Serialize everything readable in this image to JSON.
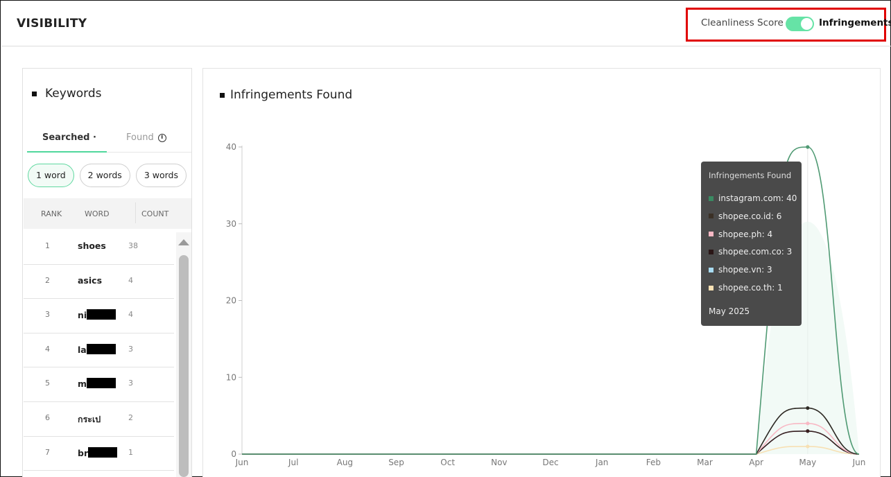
{
  "header": {
    "title": "VISIBILITY",
    "toggle": {
      "left_label": "Cleanliness Score",
      "right_label": "Infringements",
      "state": "right"
    }
  },
  "keywords": {
    "title": "Keywords",
    "tabs": {
      "searched": "Searched ·",
      "found": "Found"
    },
    "pills": [
      "1 word",
      "2 words",
      "3 words"
    ],
    "active_pill": "1 word",
    "columns": {
      "rank": "RANK",
      "word": "WORD",
      "count": "COUNT"
    },
    "rows": [
      {
        "rank": "1",
        "word": "shoes",
        "count": "38",
        "redacted": false
      },
      {
        "rank": "2",
        "word": "asics",
        "count": "4",
        "redacted": false
      },
      {
        "rank": "3",
        "word": "ni",
        "count": "4",
        "redacted": true
      },
      {
        "rank": "4",
        "word": "la",
        "count": "3",
        "redacted": true
      },
      {
        "rank": "5",
        "word": "m",
        "count": "3",
        "redacted": true
      },
      {
        "rank": "6",
        "word": "กระเป",
        "count": "2",
        "redacted": false
      },
      {
        "rank": "7",
        "word": "br",
        "count": "1",
        "redacted": true
      }
    ]
  },
  "infringements": {
    "title": "Infringements Found",
    "tooltip": {
      "title": "Infringements Found",
      "items": [
        {
          "label": "instagram.com: 40",
          "color": "#3a8a62"
        },
        {
          "label": "shopee.co.id: 6",
          "color": "#3b3026"
        },
        {
          "label": "shopee.ph: 4",
          "color": "#f8b8c4"
        },
        {
          "label": "shopee.com.co: 3",
          "color": "#2a1616"
        },
        {
          "label": "shopee.vn: 3",
          "color": "#a8dcf2"
        },
        {
          "label": "shopee.co.th: 1",
          "color": "#f7e0b3"
        }
      ],
      "date": "May 2025"
    }
  },
  "chart_data": {
    "type": "line",
    "title": "Infringements Found",
    "x": [
      "Jun",
      "Jul",
      "Aug",
      "Sep",
      "Oct",
      "Nov",
      "Dec",
      "Jan",
      "Feb",
      "Mar",
      "Apr",
      "May",
      "Jun"
    ],
    "ylim": [
      0,
      40
    ],
    "yticks": [
      0,
      10,
      20,
      30,
      40
    ],
    "grid": false,
    "series": [
      {
        "name": "instagram.com",
        "color": "#4f9a73",
        "values": [
          0,
          0,
          0,
          0,
          0,
          0,
          0,
          0,
          0,
          0,
          0,
          40,
          0
        ]
      },
      {
        "name": "shopee.co.id",
        "color": "#2e2a24",
        "values": [
          0,
          0,
          0,
          0,
          0,
          0,
          0,
          0,
          0,
          0,
          0,
          6,
          0
        ]
      },
      {
        "name": "shopee.ph",
        "color": "#f8b8c4",
        "values": [
          0,
          0,
          0,
          0,
          0,
          0,
          0,
          0,
          0,
          0,
          0,
          4,
          0
        ]
      },
      {
        "name": "shopee.com.co",
        "color": "#3a1f1f",
        "values": [
          0,
          0,
          0,
          0,
          0,
          0,
          0,
          0,
          0,
          0,
          0,
          3,
          0
        ]
      },
      {
        "name": "shopee.vn",
        "color": "#a8dcf2",
        "values": [
          0,
          0,
          0,
          0,
          0,
          0,
          0,
          0,
          0,
          0,
          0,
          3,
          0
        ]
      },
      {
        "name": "shopee.co.th",
        "color": "#f7e0b3",
        "values": [
          0,
          0,
          0,
          0,
          0,
          0,
          0,
          0,
          0,
          0,
          0,
          1,
          0
        ]
      }
    ],
    "highlight_index": 11
  }
}
